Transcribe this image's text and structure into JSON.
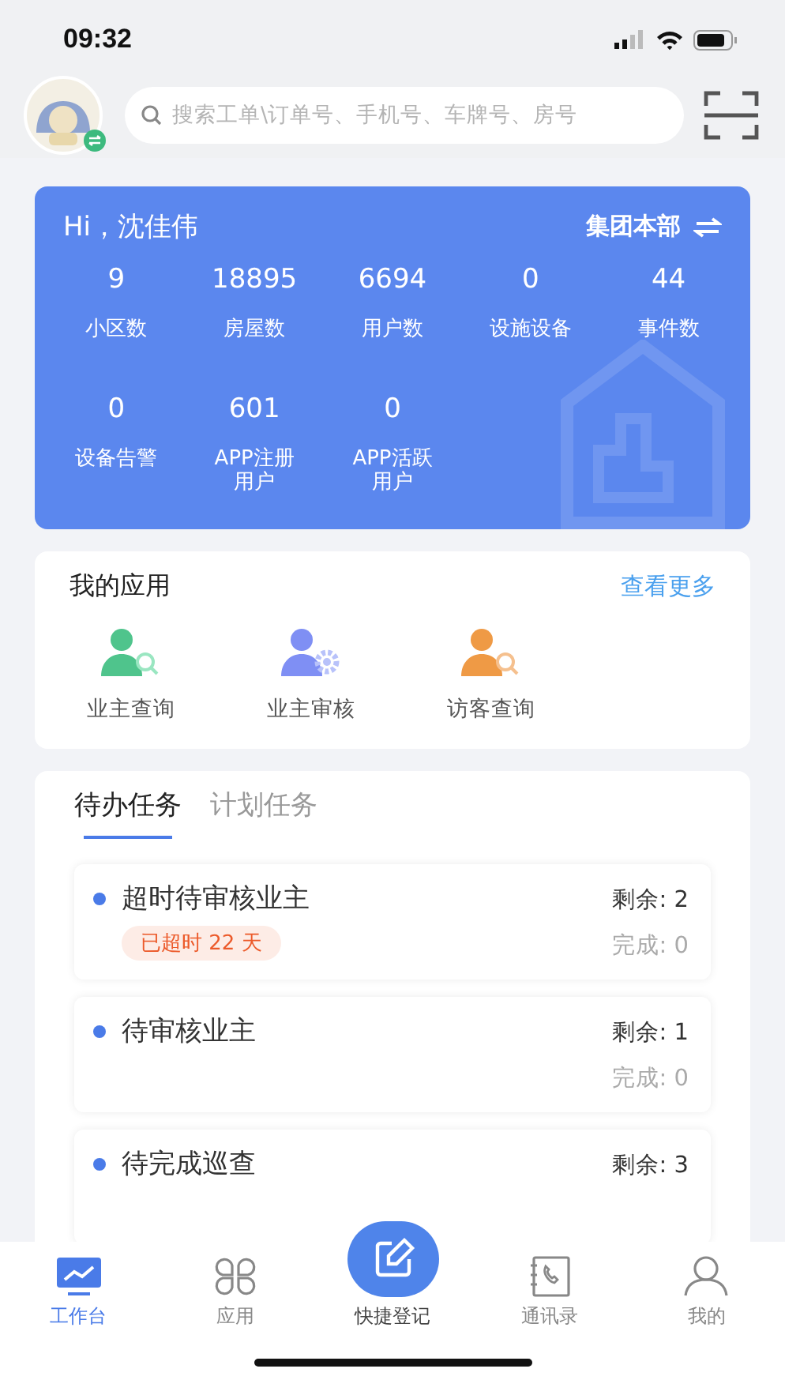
{
  "status_bar": {
    "time": "09:32"
  },
  "header": {
    "search": {
      "placeholder": "搜索工单\\订单号、手机号、车牌号、房号"
    }
  },
  "summary": {
    "greeting": "Hi，沈佳伟",
    "org": "集团本部",
    "stats": [
      {
        "value": "9",
        "label": "小区数"
      },
      {
        "value": "18895",
        "label": "房屋数"
      },
      {
        "value": "6694",
        "label": "用户数"
      },
      {
        "value": "0",
        "label": "设施设备"
      },
      {
        "value": "44",
        "label": "事件数"
      },
      {
        "value": "0",
        "label": "设备告警"
      },
      {
        "value": "601",
        "label": "APP注册用户"
      },
      {
        "value": "0",
        "label": "APP活跃用户"
      }
    ]
  },
  "apps": {
    "title": "我的应用",
    "more": "查看更多",
    "items": [
      {
        "label": "业主查询",
        "kind": "owner-search"
      },
      {
        "label": "业主审核",
        "kind": "owner-review"
      },
      {
        "label": "访客查询",
        "kind": "visitor-search"
      }
    ]
  },
  "tasks": {
    "tabs": [
      {
        "label": "待办任务",
        "selected": true
      },
      {
        "label": "计划任务",
        "selected": false
      }
    ],
    "items": [
      {
        "title": "超时待审核业主",
        "overdue": "已超时 22 天",
        "remaining": "剩余: 2",
        "done": "完成: 0"
      },
      {
        "title": "待审核业主",
        "remaining": "剩余: 1",
        "done": "完成: 0"
      },
      {
        "title": "待完成巡查",
        "remaining": "剩余: 3"
      }
    ]
  },
  "nav": [
    {
      "label": "工作台",
      "kind": "workbench",
      "selected": true
    },
    {
      "label": "应用",
      "kind": "apps",
      "selected": false
    },
    {
      "label": "快捷登记",
      "kind": "quick",
      "selected": false
    },
    {
      "label": "通讯录",
      "kind": "contacts",
      "selected": false
    },
    {
      "label": "我的",
      "kind": "profile",
      "selected": false
    }
  ]
}
